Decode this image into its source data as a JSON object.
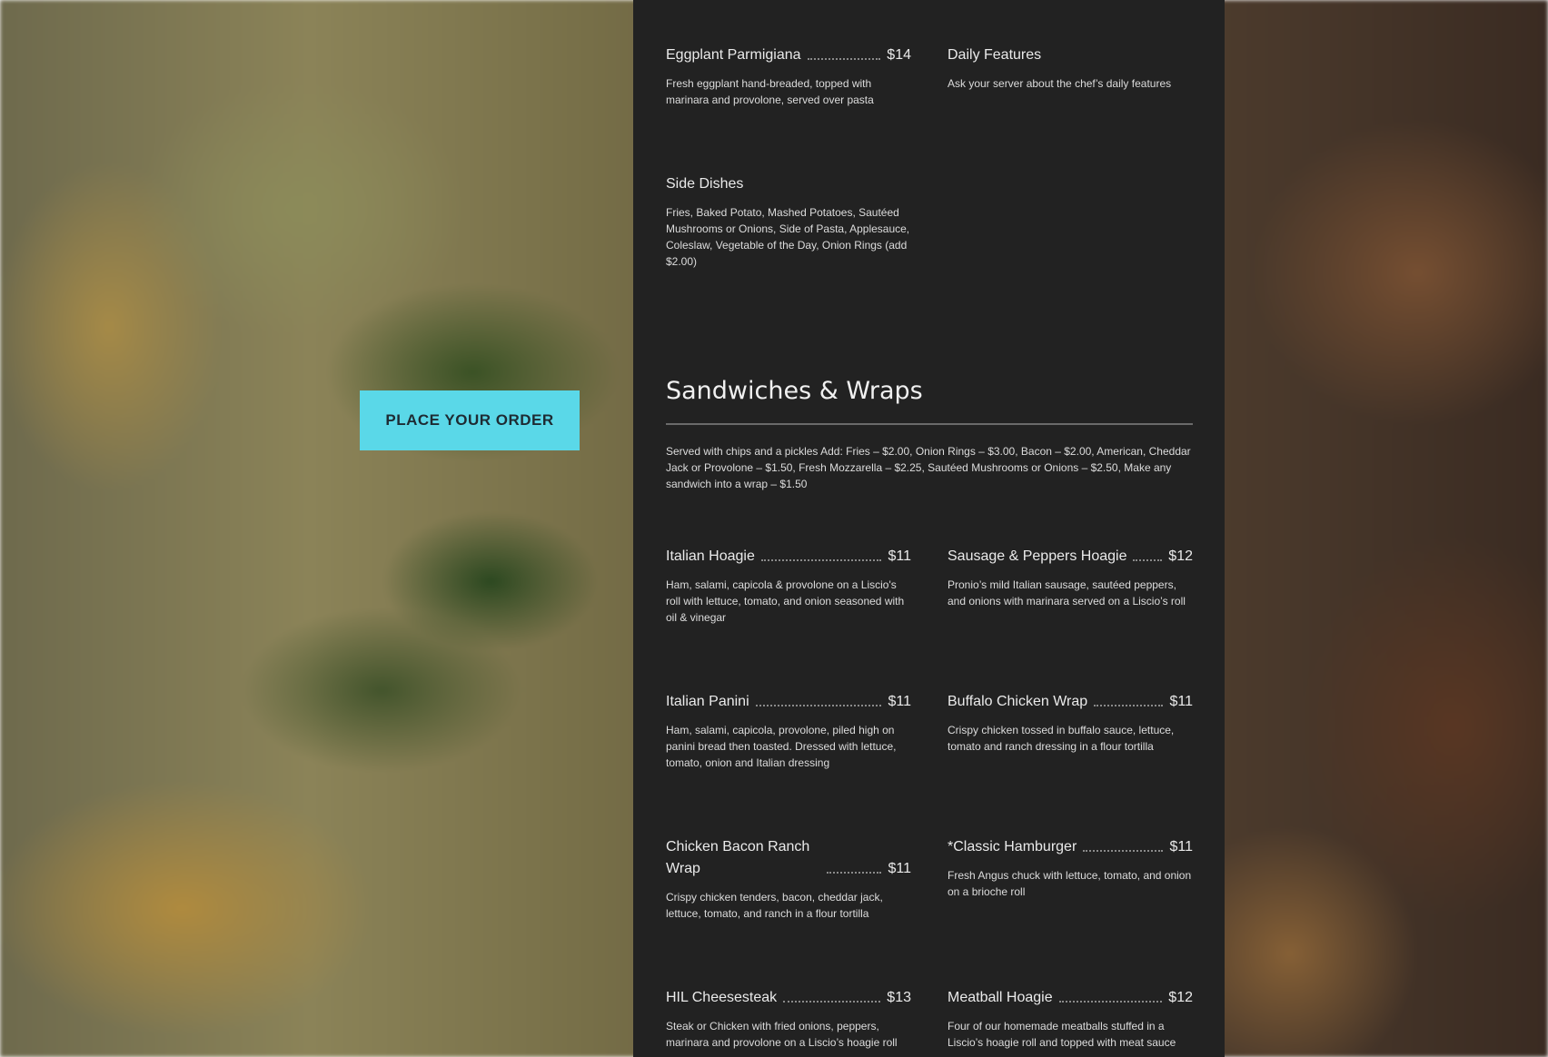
{
  "order_button": {
    "label": "PLACE YOUR ORDER"
  },
  "top_items": [
    {
      "name": "Eggplant Parmigiana",
      "price": "$14",
      "desc": "Fresh eggplant hand-breaded, topped with marinara and provolone, served over pasta"
    },
    {
      "name": "Daily Features",
      "price": "",
      "desc": "Ask your server about the chef’s daily features"
    },
    {
      "name": "Side Dishes",
      "price": "",
      "desc": "Fries, Baked Potato, Mashed Potatoes, Sautéed Mushrooms or Onions, Side of Pasta, Applesauce, Coleslaw, Vegetable of the Day, Onion Rings (add $2.00)"
    }
  ],
  "sandwiches": {
    "title": "Sandwiches & Wraps",
    "note": "Served with chips and a pickles Add: Fries – $2.00, Onion Rings – $3.00, Bacon – $2.00, American, Cheddar Jack or Provolone – $1.50, Fresh Mozzarella – $2.25, Sautéed Mushrooms or Onions – $2.50, Make any sandwich into a wrap – $1.50",
    "items": [
      {
        "name": "Italian Hoagie",
        "price": "$11",
        "desc": "Ham, salami, capicola & provolone on a Liscio's roll with lettuce, tomato, and onion seasoned with oil & vinegar"
      },
      {
        "name": "Sausage & Peppers Hoagie",
        "price": "$12",
        "desc": "Pronio’s mild Italian sausage, sautéed peppers, and onions with marinara served on a Liscio’s roll"
      },
      {
        "name": "Italian Panini",
        "price": "$11",
        "desc": "Ham, salami, capicola, provolone, piled high on panini bread then toasted. Dressed with lettuce, tomato, onion and Italian dressing"
      },
      {
        "name": "Buffalo Chicken Wrap",
        "price": "$11",
        "desc": "Crispy chicken tossed in buffalo sauce, lettuce, tomato and ranch dressing in a flour tortilla"
      },
      {
        "name": "Chicken Bacon Ranch Wrap",
        "price": "$11",
        "desc": "Crispy chicken tenders, bacon, cheddar jack, lettuce, tomato, and ranch in a flour tortilla"
      },
      {
        "name": "*Classic Hamburger",
        "price": "$11",
        "desc": "Fresh Angus chuck with lettuce, tomato, and onion on a brioche roll"
      },
      {
        "name": "HIL Cheesesteak",
        "price": "$13",
        "desc": "Steak or Chicken with fried onions, peppers, marinara and provolone on a Liscio’s hoagie roll"
      },
      {
        "name": "Meatball Hoagie",
        "price": "$12",
        "desc": "Four of our homemade meatballs stuffed in a Liscio’s hoagie roll and topped with meat sauce"
      }
    ]
  }
}
